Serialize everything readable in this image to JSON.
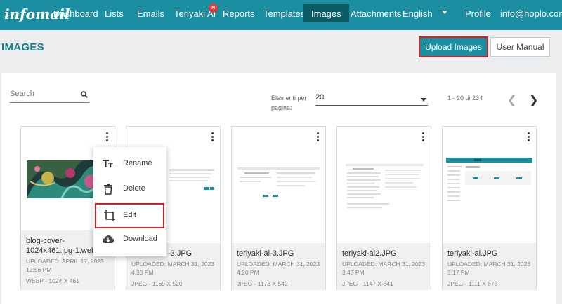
{
  "app": {
    "logo": "infomail"
  },
  "nav": {
    "items": [
      "Dashboard",
      "Lists",
      "Emails",
      "Teriyaki AI",
      "Reports",
      "Templates",
      "Images",
      "Attachments",
      "English",
      "Profile",
      "info@hoplo.com"
    ],
    "badge": "N",
    "active": "Images"
  },
  "header": {
    "title": "IMAGES",
    "upload_label": "Upload Images",
    "manual_label": "User Manual"
  },
  "toolbar": {
    "search_placeholder": "Search",
    "per_page_label": "Elementi per pagina:",
    "per_page_value": "20",
    "pagination": "1 - 20 di 234"
  },
  "colors": {
    "primary": "#1b8fa1",
    "active": "#0c5c66",
    "highlight": "#d32020",
    "badge": "#e23b3b"
  },
  "cards": [
    {
      "name": "blog-cover-1024x461.jpg-1.web",
      "uploaded": "UPLOADED: APRIL 17, 2023 12:56 PM",
      "meta": "WEBP - 1024 X 461"
    },
    {
      "name": "-3.JPG",
      "uploaded": "UPLOADED: MARCH 31, 2023 4:30 PM",
      "meta": "JPEG - 1169 X 520"
    },
    {
      "name": "teriyaki-ai-3.JPG",
      "uploaded": "UPLOADED: MARCH 31, 2023 4:20 PM",
      "meta": "JPEG - 1173 X 542"
    },
    {
      "name": "teriyaki-ai2.JPG",
      "uploaded": "UPLOADED: MARCH 31, 2023 3:45 PM",
      "meta": "JPEG - 1147 X 641"
    },
    {
      "name": "teriyaki-ai.JPG",
      "uploaded": "UPLOADED: MARCH 31, 2023 3:17 PM",
      "meta": "JPEG - 1111 X 673"
    }
  ],
  "context_menu": {
    "items": [
      {
        "label": "Rename",
        "icon": "text-format-icon"
      },
      {
        "label": "Delete",
        "icon": "trash-icon"
      },
      {
        "label": "Edit",
        "icon": "crop-icon"
      },
      {
        "label": "Download",
        "icon": "cloud-download-icon"
      }
    ]
  }
}
